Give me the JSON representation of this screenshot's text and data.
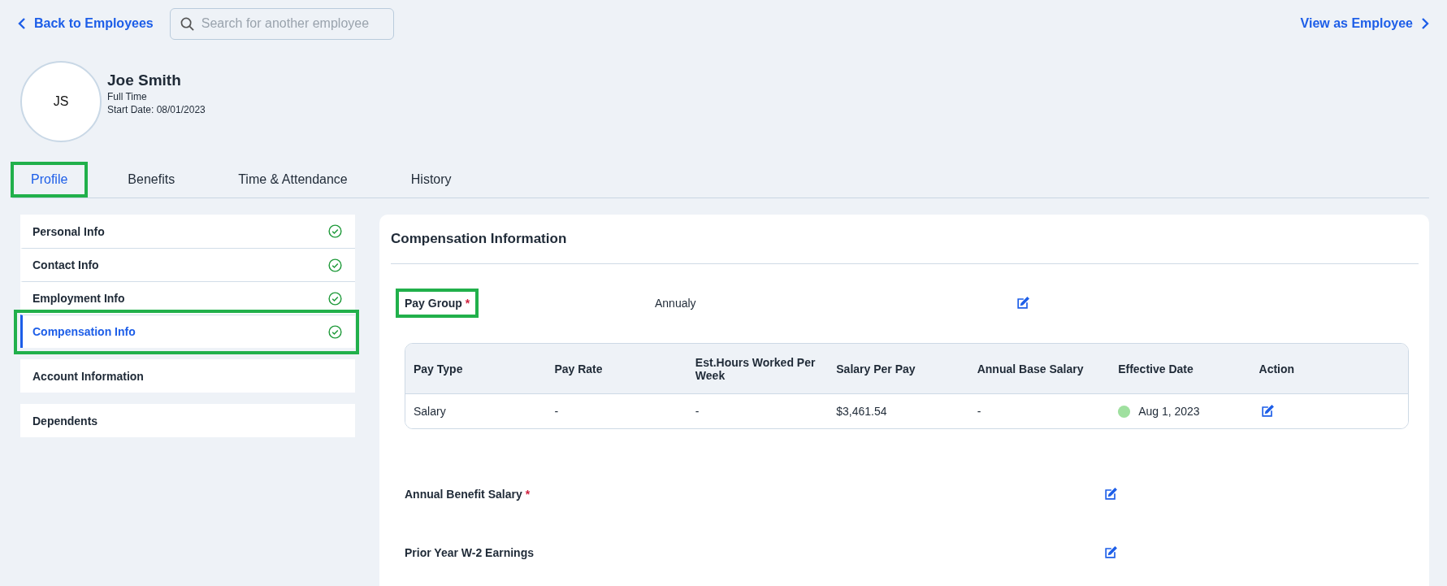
{
  "top_bar": {
    "back_link": "Back to Employees",
    "search": {
      "placeholder": "Search for another employee"
    },
    "view_link": "View as Employee"
  },
  "employee": {
    "initials": "JS",
    "name": "Joe Smith",
    "type": "Full Time",
    "start_date": "Start Date: 08/01/2023"
  },
  "tabs": [
    {
      "label": "Profile",
      "selected": true,
      "highlighted": true
    },
    {
      "label": "Benefits",
      "selected": false,
      "highlighted": false
    },
    {
      "label": "Time & Attendance",
      "selected": false,
      "highlighted": false
    },
    {
      "label": "History",
      "selected": false,
      "highlighted": false
    }
  ],
  "sidebar": {
    "groups": [
      {
        "items": [
          {
            "label": "Personal Info",
            "complete": true,
            "selected": false,
            "highlighted": false
          },
          {
            "label": "Contact Info",
            "complete": true,
            "selected": false,
            "highlighted": false
          },
          {
            "label": "Employment Info",
            "complete": true,
            "selected": false,
            "highlighted": false
          },
          {
            "label": "Compensation Info",
            "complete": true,
            "selected": true,
            "highlighted": true
          }
        ]
      },
      {
        "items": [
          {
            "label": "Account Information",
            "complete": false,
            "selected": false,
            "highlighted": false
          }
        ]
      },
      {
        "items": [
          {
            "label": "Dependents",
            "complete": false,
            "selected": false,
            "highlighted": false
          }
        ]
      }
    ]
  },
  "panel": {
    "title": "Compensation Information",
    "pay_group": {
      "label": "Pay Group",
      "required_mark": "*",
      "highlighted": true,
      "value": "Annualy"
    },
    "table": {
      "columns": [
        "Pay Type",
        "Pay Rate",
        "Est.Hours Worked Per Week",
        "Salary Per Pay",
        "Annual Base Salary",
        "Effective Date",
        "Action"
      ],
      "rows": [
        {
          "pay_type": "Salary",
          "pay_rate": "-",
          "hours": "-",
          "salary_per_pay": "$3,461.54",
          "annual_base": "-",
          "effective_date": "Aug 1, 2023",
          "color": "#9fe09f"
        }
      ]
    },
    "fields": [
      {
        "label": "Annual Benefit Salary",
        "required_mark": "*"
      },
      {
        "label": "Prior Year W-2 Earnings"
      }
    ]
  }
}
